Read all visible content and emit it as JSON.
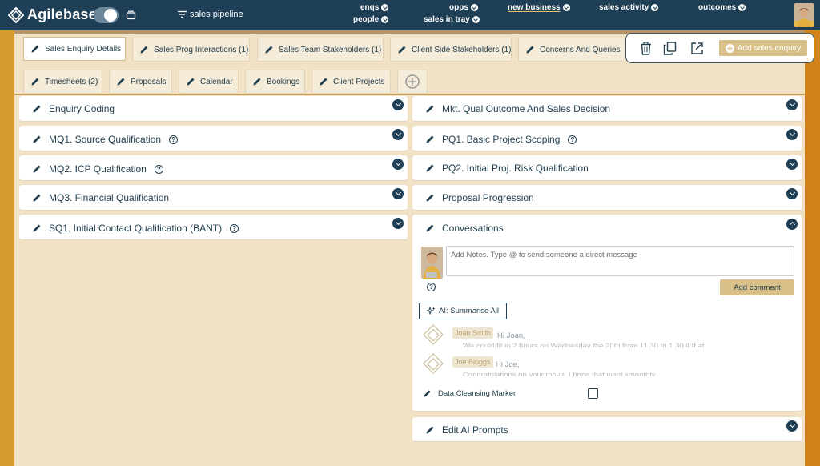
{
  "header": {
    "app_name": "Agilebase",
    "filter_label": "sales pipeline",
    "nav": [
      {
        "label": "enqs"
      },
      {
        "label": "people"
      },
      {
        "label": "opps"
      },
      {
        "label": "sales in tray"
      },
      {
        "label": "new business",
        "active": true
      },
      {
        "label": "sales activity"
      },
      {
        "label": "outcomes"
      }
    ]
  },
  "tabs_row1": [
    {
      "label": "Sales Enquiry Details",
      "active": true
    },
    {
      "label": "Sales Prog Interactions (1)"
    },
    {
      "label": "Sales Team Stakeholders (1)"
    },
    {
      "label": "Client Side Stakeholders (1)"
    },
    {
      "label": "Concerns And Queries"
    }
  ],
  "tabs_row2": [
    {
      "label": "Timesheets (2)"
    },
    {
      "label": "Proposals"
    },
    {
      "label": "Calendar"
    },
    {
      "label": "Bookings"
    },
    {
      "label": "Client Projects"
    }
  ],
  "actions": {
    "add_label": "Add sales enquiry"
  },
  "left_sections": [
    {
      "title": "Enquiry Coding",
      "help": false
    },
    {
      "title": "MQ1. Source Qualification",
      "help": true
    },
    {
      "title": "MQ2. ICP Qualification",
      "help": true
    },
    {
      "title": "MQ3. Financial Qualification",
      "help": false
    },
    {
      "title": "SQ1. Initial Contact Qualification (BANT)",
      "help": true
    }
  ],
  "right_sections": [
    {
      "title": "Mkt. Qual Outcome And Sales Decision",
      "help": false
    },
    {
      "title": "PQ1. Basic Project Scoping",
      "help": true
    },
    {
      "title": "PQ2. Initial Proj. Risk Qualification",
      "help": false
    },
    {
      "title": "Proposal Progression",
      "help": false
    },
    {
      "title": "Conversations",
      "expanded": true
    },
    {
      "title": "Edit AI Prompts",
      "help": false
    }
  ],
  "conversations": {
    "placeholder": "Add Notes. Type @ to send someone a direct message",
    "add_comment_label": "Add comment",
    "summarise_label": "AI: Summarise All",
    "help_glyph": "?",
    "messages": [
      {
        "author": "Joan Smith",
        "greeting": "Hi Joan,",
        "preview": "We could fit in 2 hours on Wednesday the 20th from 11.30 to 1.30 if that"
      },
      {
        "author": "Joe Bloggs",
        "greeting": "Hi Joe,",
        "preview": "Congratulations on your move. I hope that went smoothly"
      }
    ],
    "field_label": "Data Cleansing Marker",
    "field_checked": false
  },
  "colors": {
    "topbar": "#1f3f56",
    "page_bg": "#f1e2c6",
    "accent_gold": "#d9bf88",
    "side_left": "#d69a2d",
    "side_right": "#d18218"
  }
}
